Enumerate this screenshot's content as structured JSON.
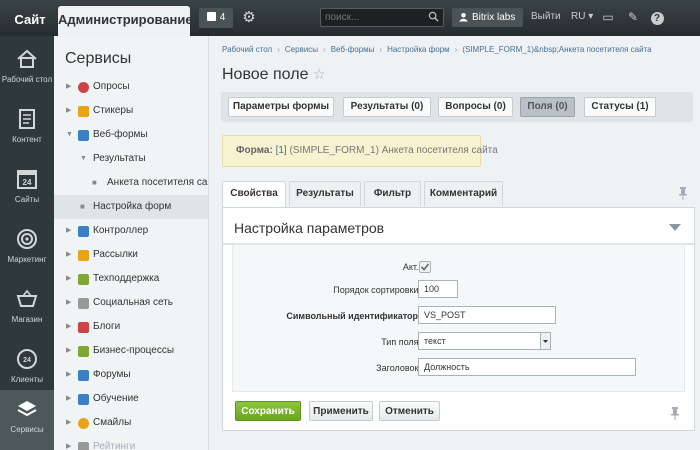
{
  "topbar": {
    "site": "Сайт",
    "admin": "Администрирование",
    "notifications_count": "4",
    "search_placeholder": "поиск...",
    "user": "Bitrix labs",
    "logout": "Выйти",
    "lang": "RU"
  },
  "rail": {
    "items": [
      {
        "label": "Рабочий стол",
        "icon": "home-icon"
      },
      {
        "label": "Контент",
        "icon": "document-icon"
      },
      {
        "label": "Сайты",
        "icon": "calendar-24-icon"
      },
      {
        "label": "Маркетинг",
        "icon": "target-icon"
      },
      {
        "label": "Магазин",
        "icon": "cart-icon"
      },
      {
        "label": "Клиенты",
        "icon": "clients-24-icon"
      },
      {
        "label": "Сервисы",
        "icon": "layers-icon"
      }
    ]
  },
  "menu": {
    "title": "Сервисы",
    "items": [
      {
        "label": "Опросы",
        "color": "#c44"
      },
      {
        "label": "Стикеры",
        "color": "#e8a317"
      },
      {
        "label": "Веб-формы",
        "color": "#3b7fc4"
      },
      {
        "label": "Результаты"
      },
      {
        "label": "Анкета посетителя сайта"
      },
      {
        "label": "Настройка форм"
      },
      {
        "label": "Контроллер",
        "color": "#3b7fc4"
      },
      {
        "label": "Рассылки",
        "color": "#e8a317"
      },
      {
        "label": "Техподдержка",
        "color": "#7fa830"
      },
      {
        "label": "Социальная сеть",
        "color": "#999"
      },
      {
        "label": "Блоги",
        "color": "#c44"
      },
      {
        "label": "Бизнес-процессы",
        "color": "#7fa830"
      },
      {
        "label": "Форумы",
        "color": "#3b7fc4"
      },
      {
        "label": "Обучение",
        "color": "#3b7fc4"
      },
      {
        "label": "Смайлы",
        "color": "#e8a317"
      },
      {
        "label": "Рейтинги",
        "color": "#999"
      }
    ]
  },
  "breadcrumbs": [
    "Рабочий стол",
    "Сервисы",
    "Веб-формы",
    "Настройка форм",
    "(SIMPLE_FORM_1)&nbsp;Анкета посетителя сайта"
  ],
  "page_title": "Новое поле",
  "top_tabs": [
    "Параметры формы",
    "Результаты (0)",
    "Вопросы (0)",
    "Поля (0)",
    "Статусы (1)"
  ],
  "note": {
    "label": "Форма:",
    "link": "[1]",
    "text": "(SIMPLE_FORM_1) Анкета посетителя сайта"
  },
  "form_tabs": [
    "Свойства",
    "Результаты",
    "Фильтр",
    "Комментарий"
  ],
  "panel": {
    "title": "Настройка параметров",
    "fields": {
      "active_label": "Акт.:",
      "sort_label": "Порядок сортировки:",
      "sort_value": "100",
      "code_label": "Символьный идентификатор:",
      "code_value": "VS_POST",
      "type_label": "Тип поля:",
      "type_value": "текст",
      "caption_label": "Заголовок:",
      "caption_value": "Должность"
    }
  },
  "buttons": {
    "save": "Сохранить",
    "apply": "Применить",
    "cancel": "Отменить"
  }
}
